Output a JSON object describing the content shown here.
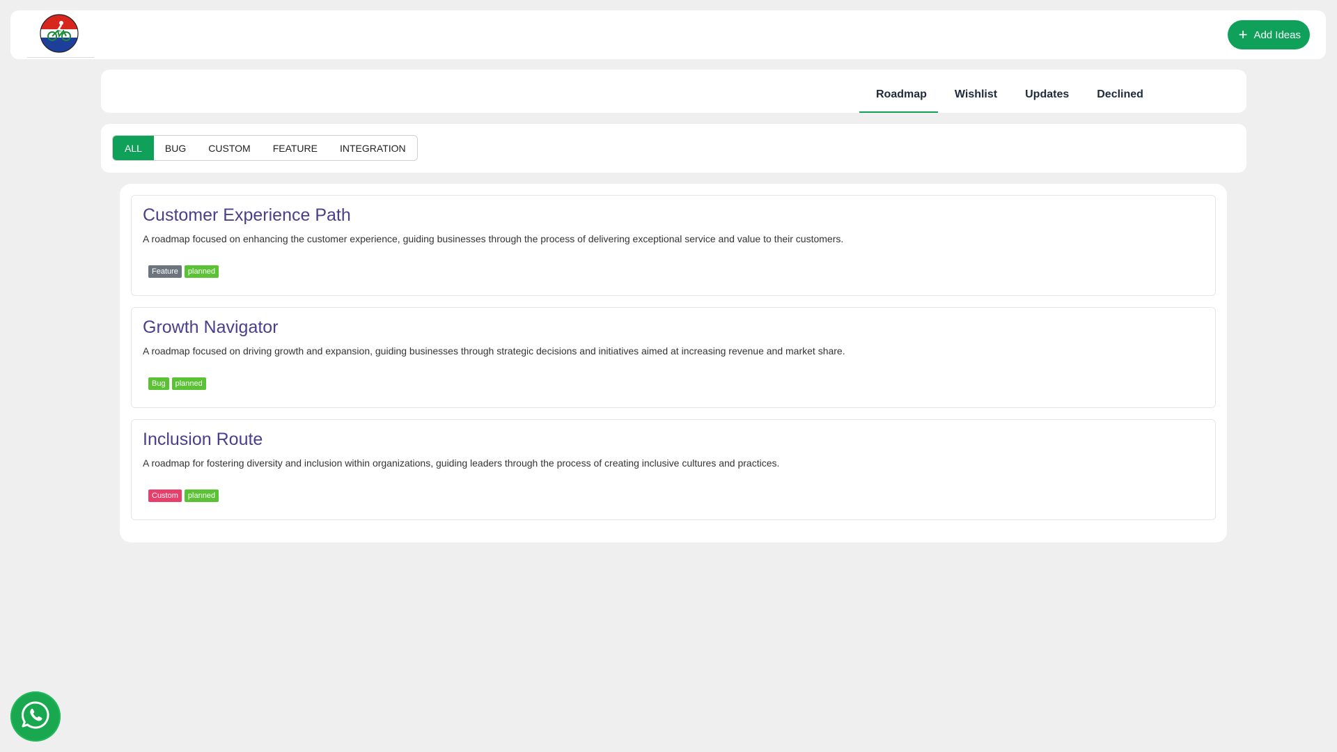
{
  "header": {
    "add_ideas_label": "Add Ideas"
  },
  "tabs": [
    {
      "label": "Roadmap",
      "active": true
    },
    {
      "label": "Wishlist",
      "active": false
    },
    {
      "label": "Updates",
      "active": false
    },
    {
      "label": "Declined",
      "active": false
    }
  ],
  "filters": [
    {
      "label": "ALL",
      "active": true
    },
    {
      "label": "BUG",
      "active": false
    },
    {
      "label": "CUSTOM",
      "active": false
    },
    {
      "label": "FEATURE",
      "active": false
    },
    {
      "label": "INTEGRATION",
      "active": false
    }
  ],
  "items": [
    {
      "title": "Customer Experience Path",
      "description": "A roadmap focused on enhancing the customer experience, guiding businesses through the process of delivering exceptional service and value to their customers.",
      "badges": [
        {
          "label": "Feature",
          "color": "#6c757d"
        },
        {
          "label": "planned",
          "color": "#5bc236"
        }
      ]
    },
    {
      "title": "Growth Navigator",
      "description": "A roadmap focused on driving growth and expansion, guiding businesses through strategic decisions and initiatives aimed at increasing revenue and market share.",
      "badges": [
        {
          "label": "Bug",
          "color": "#5bc236"
        },
        {
          "label": "planned",
          "color": "#5bc236"
        }
      ]
    },
    {
      "title": "Inclusion Route",
      "description": "A roadmap for fostering diversity and inclusion within organizations, guiding leaders through the process of creating inclusive cultures and practices.",
      "badges": [
        {
          "label": "Custom",
          "color": "#e83e6c"
        },
        {
          "label": "planned",
          "color": "#5bc236"
        }
      ]
    }
  ],
  "icons": {
    "logo": "cyclist-logo-icon",
    "add": "plus-icon",
    "chat": "whatsapp-icon"
  },
  "colors": {
    "accent": "#0fa15a",
    "title": "#4b3f8c",
    "background": "#efefef"
  }
}
